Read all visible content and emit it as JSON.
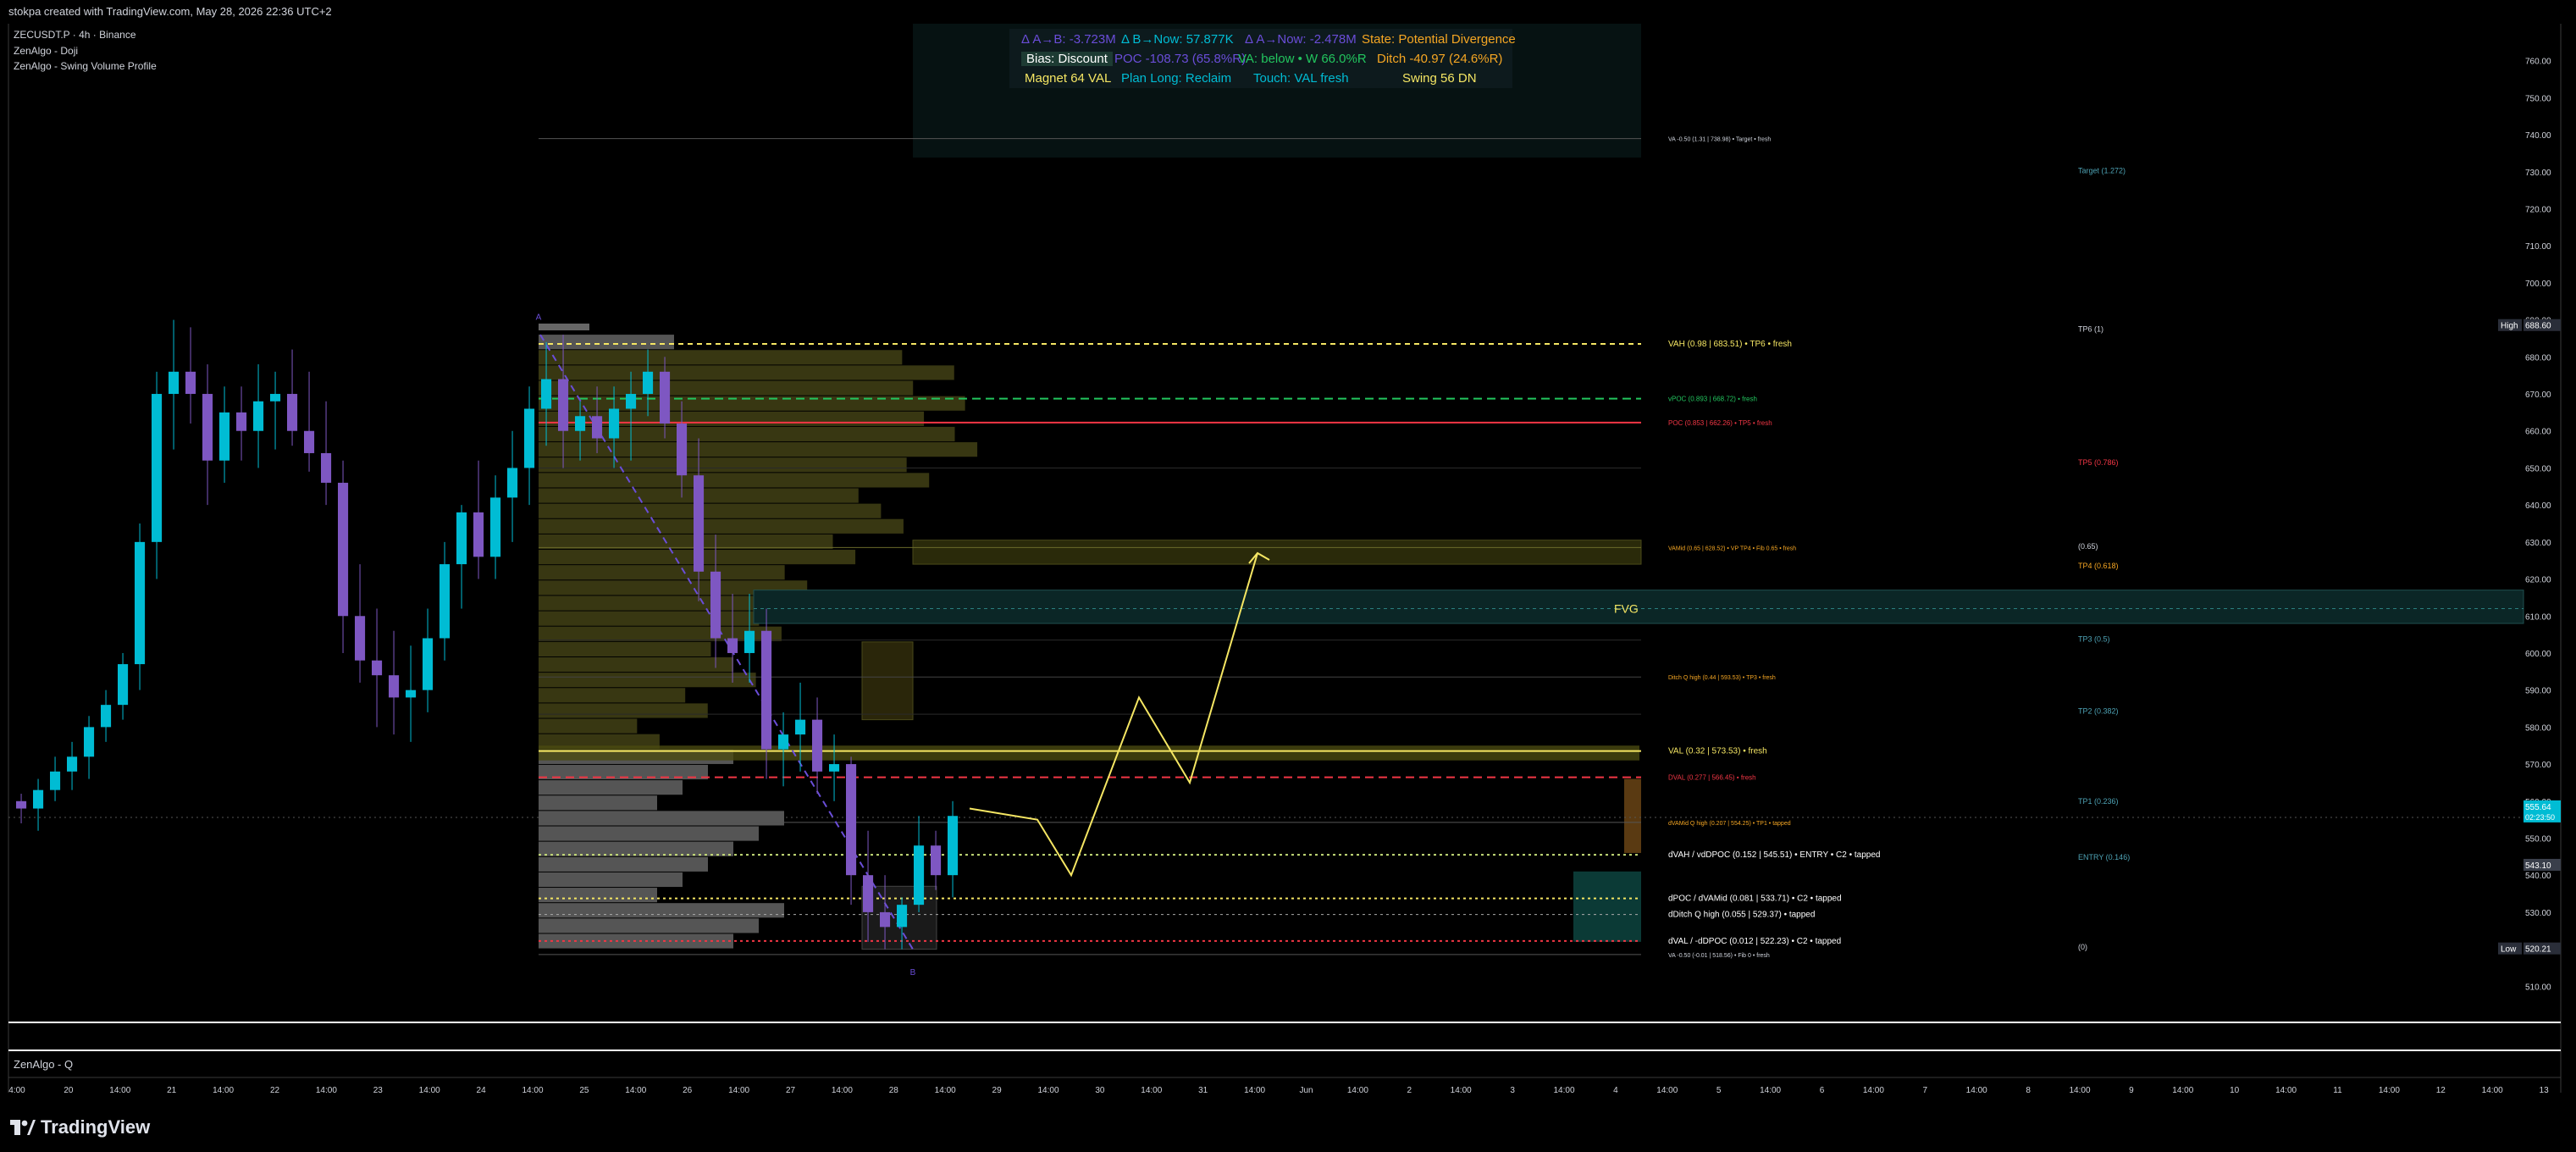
{
  "header": {
    "creator_line": "stokpa created with TradingView.com, May 28, 2026 22:36 UTC+2"
  },
  "legend": {
    "symbol": "ZECUSDT.P · 4h · Binance",
    "indicator1": "ZenAlgo - Doji",
    "indicator2": "ZenAlgo - Swing Volume Profile"
  },
  "indicator_table": {
    "row1": [
      "Δ A→B: -3.723M",
      "Δ B→Now: 57.877K",
      "Δ A→Now: -2.478M",
      "State: Potential Divergence"
    ],
    "row2": [
      "Bias: Discount",
      "POC -108.73 (65.8%R)",
      "VA: below • W 66.0%R",
      "Ditch -40.97 (24.6%R)"
    ],
    "row3": [
      "Magnet 64 VAL",
      "Plan Long: Reclaim",
      "Touch: VAL fresh",
      "Swing 56 DN"
    ]
  },
  "colors": {
    "bull": "#00bcd4",
    "bear": "#7e57c2",
    "poc": "#f23645",
    "yellow": "#f5e663",
    "green": "#22c55e",
    "profile_olive": "#3b3a13",
    "profile_gray": "#5a5a5a"
  },
  "level_labels": [
    {
      "text": "VA -0.50 (1.31 | 738.98) • Target • fresh",
      "price": 738.98,
      "color": "#cfd3dc"
    },
    {
      "text": "VAH (0.98 | 683.51) • TP6 • fresh",
      "price": 683.51,
      "color": "#f5e663"
    },
    {
      "text": "vPOC (0.893 | 668.72) • fresh",
      "price": 668.72,
      "color": "#22c55e"
    },
    {
      "text": "POC (0.853 | 662.26) • TP5 • fresh",
      "price": 662.26,
      "color": "#f23645"
    },
    {
      "text": "VAMid (0.65 | 628.52) • VP TP4 • Fib 0.65 • fresh",
      "price": 628.52,
      "color": "#f5a623"
    },
    {
      "text": "Ditch Q high (0.44 | 593.53) • TP3 • fresh",
      "price": 593.53,
      "color": "#f5a623"
    },
    {
      "text": "VAL (0.32 | 573.53) • fresh",
      "price": 573.53,
      "color": "#f5e663"
    },
    {
      "text": "DVAL (0.277 | 566.45) • fresh",
      "price": 566.45,
      "color": "#f23645"
    },
    {
      "text": "dVAMid Q high (0.207 | 554.25) • TP1 • tapped",
      "price": 554.25,
      "color": "#f5a623"
    },
    {
      "text": "dVAH / vdDPOC (0.152 | 545.51) • ENTRY • C2 • tapped",
      "price": 545.51,
      "color": "#ffffff"
    },
    {
      "text": "dPOC / dVAMid (0.081 | 533.71) • C2 • tapped",
      "price": 533.71,
      "color": "#ffffff"
    },
    {
      "text": "dDitch Q high (0.055 | 529.37) • tapped",
      "price": 529.37,
      "color": "#ffffff"
    },
    {
      "text": "dVAL / -dDPOC (0.012 | 522.23) • C2 • tapped",
      "price": 522.23,
      "color": "#ffffff"
    },
    {
      "text": "VA -0.50 (-0.01 | 518.56) • Fib 0 • fresh",
      "price": 518.56,
      "color": "#cfd3dc"
    }
  ],
  "fib_labels": [
    {
      "text": "Target (1.272)",
      "price": 730.3
    },
    {
      "text": "TP6 (1)",
      "price": 687.5
    },
    {
      "text": "TP5 (0.786)",
      "price": 651.5
    },
    {
      "text": "(0.65)",
      "price": 628.8
    },
    {
      "text": "TP4 (0.618)",
      "price": 623.6
    },
    {
      "text": "TP3 (0.5)",
      "price": 603.8
    },
    {
      "text": "TP2 (0.382)",
      "price": 584.3
    },
    {
      "text": "TP1 (0.236)",
      "price": 560.0
    },
    {
      "text": "ENTRY (0.146)",
      "price": 544.8
    },
    {
      "text": "(0)",
      "price": 520.6
    }
  ],
  "fvg_label": "FVG",
  "point_labels": {
    "a": "A",
    "b": "B"
  },
  "price_tags": {
    "high_label": "High",
    "high_value": "688.60",
    "current_value": "555.64",
    "countdown": "02:23:50",
    "low_label": "Low",
    "low_value": "520.21",
    "mid_value": "543.10"
  },
  "lower_pane_label": "ZenAlgo - Q",
  "footer": {
    "brand": "TradingView"
  },
  "chart_data": {
    "type": "candlestick",
    "title": "ZECUSDT.P · 4h · Binance",
    "ylim": [
      500,
      770
    ],
    "y_ticks": [
      760,
      750,
      740,
      730,
      720,
      710,
      700,
      690,
      680,
      670,
      660,
      650,
      640,
      630,
      620,
      610,
      600,
      590,
      580,
      570,
      560,
      550,
      540,
      530,
      520,
      510
    ],
    "x_ticks": [
      "4:00",
      "20",
      "14:00",
      "21",
      "14:00",
      "22",
      "14:00",
      "23",
      "14:00",
      "24",
      "14:00",
      "25",
      "14:00",
      "26",
      "14:00",
      "27",
      "14:00",
      "28",
      "14:00",
      "29",
      "14:00",
      "30",
      "14:00",
      "31",
      "14:00",
      "Jun",
      "14:00",
      "2",
      "14:00",
      "3",
      "14:00",
      "4",
      "14:00",
      "5",
      "14:00",
      "6",
      "14:00",
      "7",
      "14:00",
      "8",
      "14:00",
      "9",
      "14:00",
      "10",
      "14:00",
      "11",
      "14:00",
      "12",
      "14:00",
      "13"
    ],
    "candles": [
      [
        560,
        562,
        554,
        558
      ],
      [
        558,
        566,
        552,
        563
      ],
      [
        563,
        572,
        560,
        568
      ],
      [
        568,
        576,
        563,
        572
      ],
      [
        572,
        583,
        566,
        580
      ],
      [
        580,
        590,
        576,
        586
      ],
      [
        586,
        600,
        582,
        597
      ],
      [
        597,
        635,
        590,
        630
      ],
      [
        630,
        676,
        620,
        670
      ],
      [
        670,
        690,
        655,
        676
      ],
      [
        676,
        688,
        662,
        670
      ],
      [
        670,
        678,
        640,
        652
      ],
      [
        652,
        672,
        646,
        665
      ],
      [
        665,
        672,
        652,
        660
      ],
      [
        660,
        678,
        650,
        668
      ],
      [
        668,
        676,
        655,
        670
      ],
      [
        670,
        682,
        656,
        660
      ],
      [
        660,
        676,
        649,
        654
      ],
      [
        654,
        668,
        640,
        646
      ],
      [
        646,
        652,
        600,
        610
      ],
      [
        610,
        624,
        592,
        598
      ],
      [
        598,
        612,
        580,
        594
      ],
      [
        594,
        606,
        578,
        588
      ],
      [
        588,
        602,
        576,
        590
      ],
      [
        590,
        612,
        584,
        604
      ],
      [
        604,
        630,
        598,
        624
      ],
      [
        624,
        640,
        612,
        638
      ],
      [
        638,
        652,
        620,
        626
      ],
      [
        626,
        648,
        620,
        642
      ],
      [
        642,
        660,
        630,
        650
      ],
      [
        650,
        672,
        640,
        666
      ],
      [
        666,
        684,
        656,
        674
      ],
      [
        674,
        686,
        650,
        660
      ],
      [
        660,
        668,
        652,
        664
      ],
      [
        664,
        672,
        654,
        658
      ],
      [
        658,
        672,
        650,
        666
      ],
      [
        666,
        676,
        652,
        670
      ],
      [
        670,
        682,
        664,
        676
      ],
      [
        676,
        680,
        658,
        662
      ],
      [
        662,
        668,
        642,
        648
      ],
      [
        648,
        658,
        614,
        622
      ],
      [
        622,
        632,
        596,
        604
      ],
      [
        604,
        616,
        592,
        600
      ],
      [
        600,
        616,
        592,
        606
      ],
      [
        606,
        612,
        566,
        574
      ],
      [
        574,
        584,
        564,
        578
      ],
      [
        578,
        592,
        568,
        582
      ],
      [
        582,
        588,
        562,
        568
      ],
      [
        568,
        578,
        560,
        570
      ],
      [
        570,
        572,
        532,
        540
      ],
      [
        540,
        552,
        522,
        530
      ],
      [
        530,
        540,
        520,
        526
      ],
      [
        526,
        534,
        520,
        532
      ],
      [
        532,
        556,
        530,
        548
      ],
      [
        548,
        552,
        536,
        540
      ],
      [
        540,
        560,
        534,
        556
      ]
    ],
    "projection": [
      [
        60,
        555
      ],
      [
        62,
        540
      ],
      [
        66,
        588
      ],
      [
        69,
        565
      ],
      [
        73,
        627
      ]
    ]
  }
}
